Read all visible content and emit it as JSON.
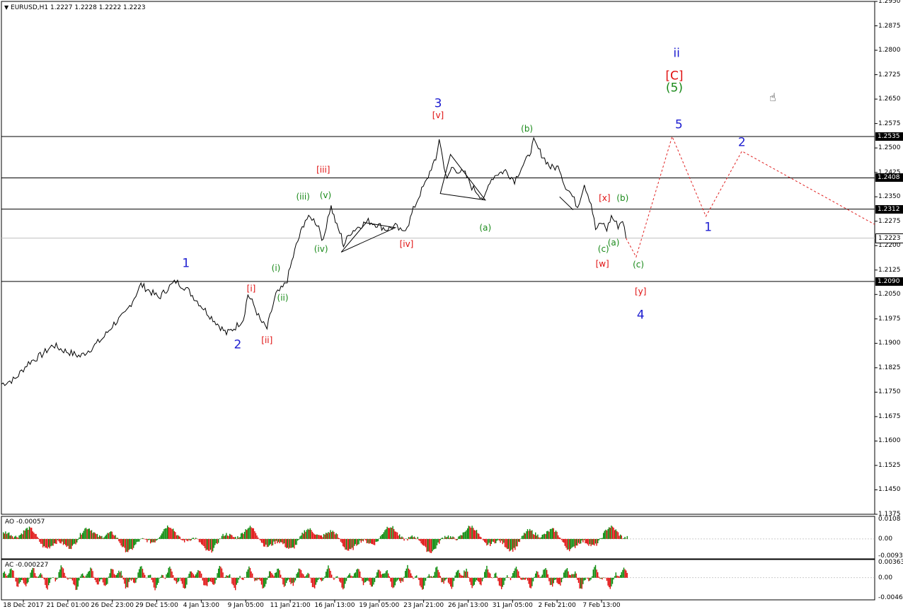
{
  "title": "EURUSD,H1  1.2227 1.2228 1.2222 1.2223",
  "chart_data": {
    "type": "candlestick",
    "symbol": "EURUSD",
    "timeframe": "H1",
    "ohlc": {
      "open": 1.2227,
      "high": 1.2228,
      "low": 1.2222,
      "close": 1.2223
    },
    "ylim": [
      1.1375,
      1.295
    ],
    "y_ticks": [
      "1.2950",
      "1.2875",
      "1.2800",
      "1.2725",
      "1.2650",
      "1.2575",
      "1.2500",
      "1.2425",
      "1.2350",
      "1.2275",
      "1.2200",
      "1.2125",
      "1.2050",
      "1.1975",
      "1.1900",
      "1.1825",
      "1.1750",
      "1.1675",
      "1.1600",
      "1.1525",
      "1.1450",
      "1.1375"
    ],
    "x_ticks": [
      "18 Dec 2017",
      "21 Dec 01:00",
      "26 Dec 23:00",
      "29 Dec 15:00",
      "4 Jan 13:00",
      "9 Jan 05:00",
      "11 Jan 21:00",
      "16 Jan 13:00",
      "19 Jan 05:00",
      "23 Jan 21:00",
      "26 Jan 13:00",
      "31 Jan 05:00",
      "2 Feb 21:00",
      "7 Feb 13:00"
    ],
    "price_path": [
      [
        0,
        1.1775
      ],
      [
        0.6,
        1.179
      ],
      [
        1.2,
        1.184
      ],
      [
        1.8,
        1.1865
      ],
      [
        2.3,
        1.1895
      ],
      [
        2.7,
        1.188
      ],
      [
        3.1,
        1.187
      ],
      [
        3.5,
        1.186
      ],
      [
        4.0,
        1.1885
      ],
      [
        4.5,
        1.1915
      ],
      [
        5.0,
        1.196
      ],
      [
        5.5,
        1.199
      ],
      [
        5.9,
        1.204
      ],
      [
        6.2,
        1.208
      ],
      [
        6.6,
        1.206
      ],
      [
        7.0,
        1.204
      ],
      [
        7.4,
        1.207
      ],
      [
        7.75,
        1.209
      ],
      [
        8.2,
        1.207
      ],
      [
        8.7,
        1.203
      ],
      [
        9.2,
        1.199
      ],
      [
        9.6,
        1.196
      ],
      [
        10.0,
        1.193
      ],
      [
        10.4,
        1.195
      ],
      [
        10.75,
        1.1975
      ],
      [
        10.95,
        1.205
      ],
      [
        11.2,
        1.202
      ],
      [
        11.5,
        1.197
      ],
      [
        11.8,
        1.1945
      ],
      [
        12.0,
        1.2
      ],
      [
        12.2,
        1.205
      ],
      [
        12.5,
        1.207
      ],
      [
        12.7,
        1.2095
      ],
      [
        12.9,
        1.215
      ],
      [
        13.1,
        1.22
      ],
      [
        13.3,
        1.224
      ],
      [
        13.5,
        1.228
      ],
      [
        13.8,
        1.2285
      ],
      [
        14.1,
        1.226
      ],
      [
        14.3,
        1.221
      ],
      [
        14.5,
        1.229
      ],
      [
        14.65,
        1.232
      ],
      [
        14.9,
        1.226
      ],
      [
        15.1,
        1.223
      ],
      [
        15.2,
        1.22
      ],
      [
        15.5,
        1.224
      ],
      [
        15.9,
        1.226
      ],
      [
        16.3,
        1.2275
      ],
      [
        16.7,
        1.2265
      ],
      [
        17.1,
        1.225
      ],
      [
        17.5,
        1.226
      ],
      [
        17.8,
        1.224
      ],
      [
        18.1,
        1.227
      ],
      [
        18.3,
        1.231
      ],
      [
        18.6,
        1.236
      ],
      [
        18.9,
        1.24
      ],
      [
        19.1,
        1.244
      ],
      [
        19.3,
        1.246
      ],
      [
        19.45,
        1.253
      ],
      [
        19.6,
        1.247
      ],
      [
        19.8,
        1.24
      ],
      [
        20.0,
        1.244
      ],
      [
        20.3,
        1.243
      ],
      [
        20.6,
        1.242
      ],
      [
        20.9,
        1.238
      ],
      [
        21.2,
        1.236
      ],
      [
        21.45,
        1.234
      ],
      [
        21.7,
        1.24
      ],
      [
        22.0,
        1.242
      ],
      [
        22.4,
        1.243
      ],
      [
        22.8,
        1.24
      ],
      [
        23.1,
        1.244
      ],
      [
        23.4,
        1.247
      ],
      [
        23.65,
        1.252
      ],
      [
        24.0,
        1.248
      ],
      [
        24.4,
        1.244
      ],
      [
        24.8,
        1.244
      ],
      [
        25.0,
        1.239
      ],
      [
        25.3,
        1.236
      ],
      [
        25.6,
        1.232
      ],
      [
        25.9,
        1.239
      ],
      [
        26.2,
        1.233
      ],
      [
        26.4,
        1.225
      ],
      [
        26.7,
        1.227
      ],
      [
        26.9,
        1.225
      ],
      [
        27.1,
        1.229
      ],
      [
        27.4,
        1.226
      ],
      [
        27.6,
        1.228
      ],
      [
        27.75,
        1.2223
      ]
    ],
    "horizontal_levels": [
      1.2535,
      1.2408,
      1.2312,
      1.209
    ],
    "current_price": 1.2223,
    "projection": [
      [
        27.75,
        1.2223
      ],
      [
        28.2,
        1.2165
      ],
      [
        29.8,
        1.2535
      ],
      [
        31.3,
        1.229
      ],
      [
        32.9,
        1.249
      ],
      [
        38.8,
        1.2265
      ]
    ],
    "annotations": [
      {
        "text": "1",
        "color": "blue",
        "size": "big",
        "x": 8.2,
        "y": 1.2145
      },
      {
        "text": "2",
        "color": "blue",
        "size": "big",
        "x": 10.5,
        "y": 1.1895
      },
      {
        "text": "3",
        "color": "blue",
        "size": "big",
        "x": 19.4,
        "y": 1.2635
      },
      {
        "text": "4",
        "color": "blue",
        "size": "big",
        "x": 28.4,
        "y": 1.1985
      },
      {
        "text": "5",
        "color": "blue",
        "size": "big",
        "x": 30.1,
        "y": 1.257
      },
      {
        "text": "ii",
        "color": "blue",
        "size": "big",
        "x": 30.0,
        "y": 1.279
      },
      {
        "text": "1",
        "color": "blue",
        "size": "big",
        "x": 31.4,
        "y": 1.2255
      },
      {
        "text": "2",
        "color": "blue",
        "size": "big",
        "x": 32.9,
        "y": 1.2515
      },
      {
        "text": "[C]",
        "color": "red",
        "size": "big",
        "x": 29.9,
        "y": 1.272
      },
      {
        "text": "(5)",
        "color": "green",
        "size": "big",
        "x": 29.9,
        "y": 1.2683
      },
      {
        "text": "[i]",
        "color": "red",
        "x": 11.1,
        "y": 1.2068
      },
      {
        "text": "[ii]",
        "color": "red",
        "x": 11.8,
        "y": 1.191
      },
      {
        "text": "[iii]",
        "color": "red",
        "x": 14.3,
        "y": 1.2432
      },
      {
        "text": "[iv]",
        "color": "red",
        "x": 18.0,
        "y": 1.2205
      },
      {
        "text": "[v]",
        "color": "red",
        "x": 19.4,
        "y": 1.26
      },
      {
        "text": "[w]",
        "color": "red",
        "x": 26.7,
        "y": 1.2145
      },
      {
        "text": "[x]",
        "color": "red",
        "x": 26.8,
        "y": 1.2347
      },
      {
        "text": "[y]",
        "color": "red",
        "x": 28.4,
        "y": 1.206
      },
      {
        "text": "(i)",
        "color": "green",
        "x": 12.2,
        "y": 1.213
      },
      {
        "text": "(ii)",
        "color": "green",
        "x": 12.5,
        "y": 1.204
      },
      {
        "text": "(iii)",
        "color": "green",
        "x": 13.4,
        "y": 1.235
      },
      {
        "text": "(iv)",
        "color": "green",
        "x": 14.2,
        "y": 1.219
      },
      {
        "text": "(v)",
        "color": "green",
        "x": 14.4,
        "y": 1.2355
      },
      {
        "text": "(a)",
        "color": "green",
        "x": 21.5,
        "y": 1.2255
      },
      {
        "text": "(b)",
        "color": "green",
        "x": 23.35,
        "y": 1.256
      },
      {
        "text": "(c)",
        "color": "green",
        "x": 26.75,
        "y": 1.219
      },
      {
        "text": "(a)",
        "color": "green",
        "x": 27.2,
        "y": 1.221
      },
      {
        "text": "(b)",
        "color": "green",
        "x": 27.6,
        "y": 1.2345
      },
      {
        "text": "(c)",
        "color": "green",
        "x": 28.3,
        "y": 1.2142
      }
    ],
    "triangles": [
      [
        [
          16.2,
          1.227
        ],
        [
          17.5,
          1.2255
        ],
        [
          15.1,
          1.218
        ]
      ],
      [
        [
          19.95,
          1.248
        ],
        [
          21.5,
          1.234
        ],
        [
          19.5,
          1.236
        ]
      ],
      [
        [
          24.8,
          1.235
        ],
        [
          25.4,
          1.231
        ]
      ]
    ],
    "ao": {
      "label": "AO -0.00057",
      "ylim": [
        -0.011,
        0.0125
      ],
      "y_ticks": [
        "0.0108",
        "0.00",
        "-0.00932"
      ]
    },
    "ac": {
      "label": "AC -0.000227",
      "ylim": [
        -0.0052,
        0.0043
      ],
      "y_ticks": [
        "0.003631",
        "0.00",
        "-0.00465"
      ]
    },
    "colors": {
      "up": "#0a8a0a",
      "down": "#e01010",
      "price": "#000000",
      "projection": "#e02020",
      "blue": "#1c1cd0",
      "red": "#e01010",
      "green": "#1a8a1a"
    }
  }
}
